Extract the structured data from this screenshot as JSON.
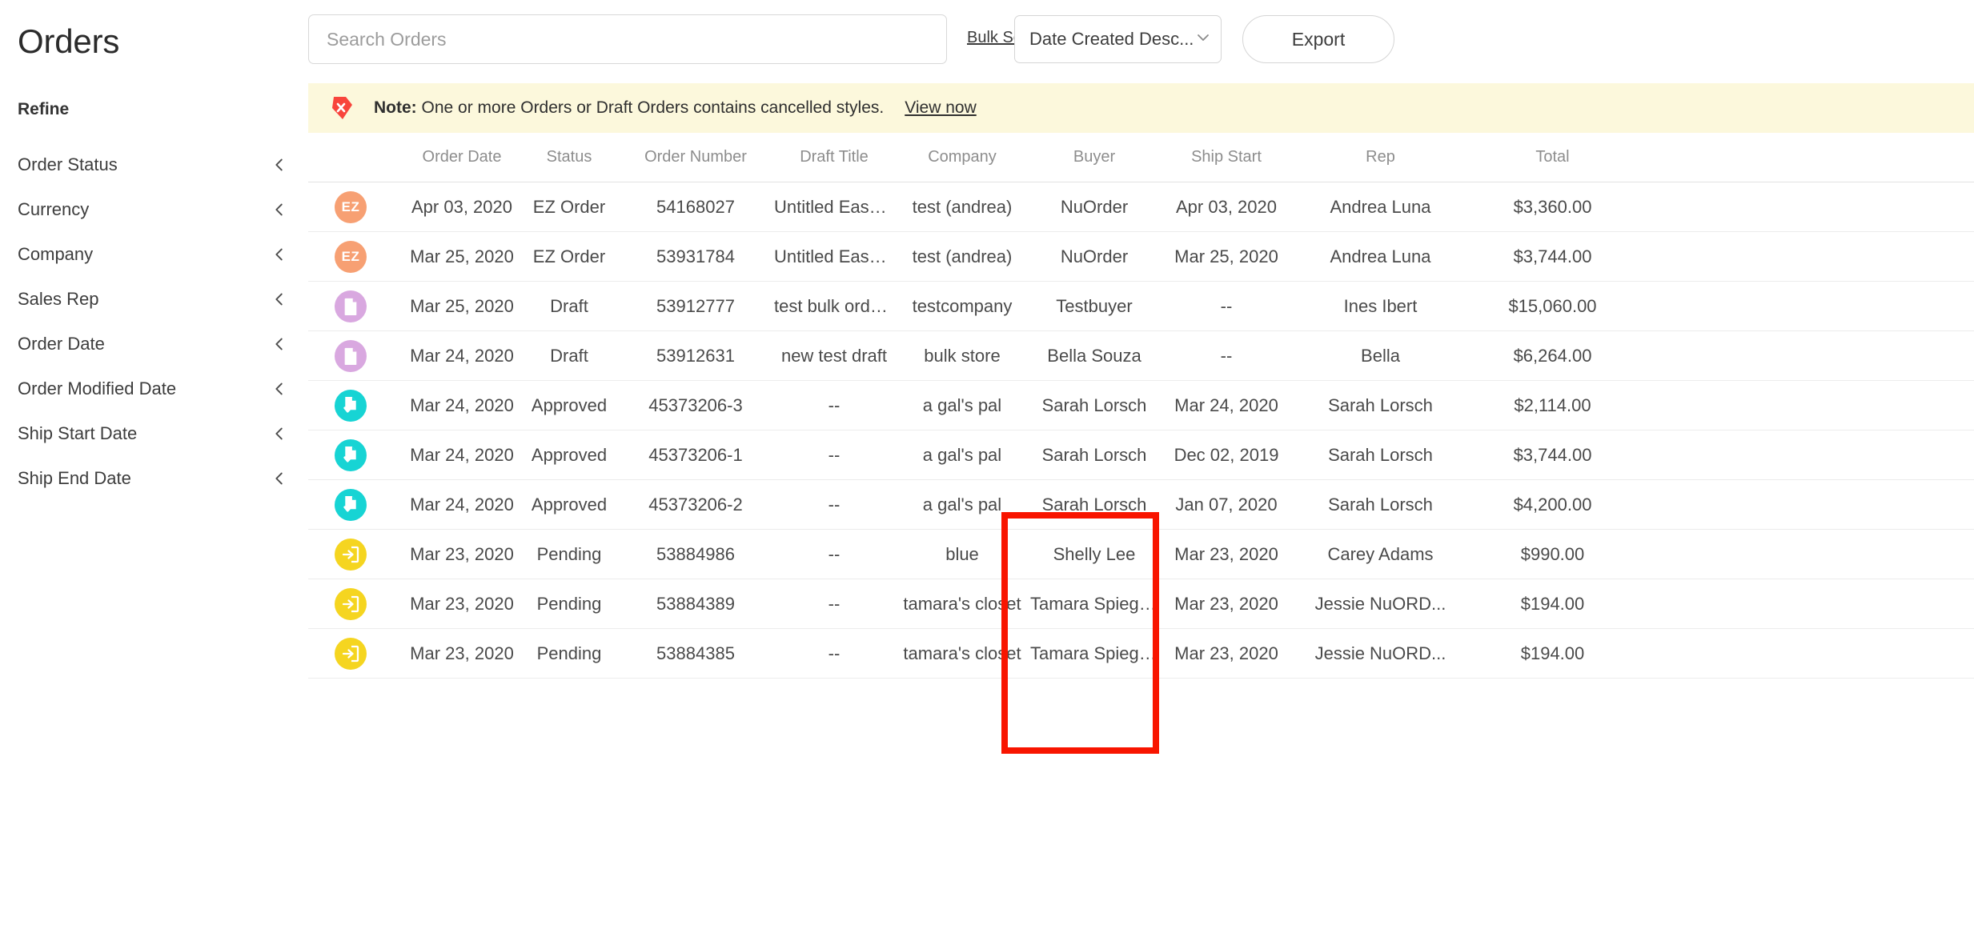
{
  "header": {
    "title": "Orders"
  },
  "sidebar": {
    "refine_label": "Refine",
    "items": [
      {
        "label": "Order Status",
        "icon": "chevron-left-icon"
      },
      {
        "label": "Currency",
        "icon": "chevron-left-icon"
      },
      {
        "label": "Company",
        "icon": "chevron-left-icon"
      },
      {
        "label": "Sales Rep",
        "icon": "chevron-left-icon"
      },
      {
        "label": "Order Date",
        "icon": "chevron-left-icon"
      },
      {
        "label": "Order Modified Date",
        "icon": "chevron-left-icon"
      },
      {
        "label": "Ship Start Date",
        "icon": "chevron-left-icon"
      },
      {
        "label": "Ship End Date",
        "icon": "chevron-left-icon"
      }
    ]
  },
  "toolbar": {
    "search_value": "",
    "search_placeholder": "Search Orders",
    "bulk_search_label": "Bulk Search",
    "sort_value": "Date Created Desc...",
    "sort_icon": "chevron-down-icon",
    "export_label": "Export"
  },
  "note": {
    "icon": "cancelled-tag-icon",
    "prefix": "Note:",
    "message": "One or more Orders or Draft Orders contains cancelled styles.",
    "link_label": "View now",
    "background": "#fcf8dc"
  },
  "table": {
    "columns": [
      {
        "key": "icon",
        "label": ""
      },
      {
        "key": "order_date",
        "label": "Order Date"
      },
      {
        "key": "status",
        "label": "Status"
      },
      {
        "key": "order_number",
        "label": "Order Number"
      },
      {
        "key": "draft_title",
        "label": "Draft Title"
      },
      {
        "key": "company",
        "label": "Company"
      },
      {
        "key": "buyer",
        "label": "Buyer"
      },
      {
        "key": "ship_start",
        "label": "Ship Start"
      },
      {
        "key": "rep",
        "label": "Rep"
      },
      {
        "key": "total",
        "label": "Total"
      }
    ],
    "rows": [
      {
        "icon": "ez-order-icon",
        "icon_color": "#f7a073",
        "icon_glyph": "EZ",
        "order_date": "Apr 03, 2020",
        "status": "EZ Order",
        "order_number": "54168027",
        "draft_title": "Untitled Easy ...",
        "company": "test (andrea)",
        "buyer": "NuOrder",
        "ship_start": "Apr 03, 2020",
        "rep": "Andrea Luna",
        "total": "$3,360.00"
      },
      {
        "icon": "ez-order-icon",
        "icon_color": "#f7a073",
        "icon_glyph": "EZ",
        "order_date": "Mar 25, 2020",
        "status": "EZ Order",
        "order_number": "53931784",
        "draft_title": "Untitled Easy ...",
        "company": "test (andrea)",
        "buyer": "NuOrder",
        "ship_start": "Mar 25, 2020",
        "rep": "Andrea Luna",
        "total": "$3,744.00"
      },
      {
        "icon": "draft-order-icon",
        "icon_color": "#d9a8e0",
        "icon_glyph": "document",
        "order_date": "Mar 25, 2020",
        "status": "Draft",
        "order_number": "53912777",
        "draft_title": "test bulk order...",
        "company": "testcompany",
        "buyer": "Testbuyer",
        "ship_start": "--",
        "rep": "Ines Ibert",
        "total": "$15,060.00"
      },
      {
        "icon": "draft-order-icon",
        "icon_color": "#d9a8e0",
        "icon_glyph": "document",
        "order_date": "Mar 24, 2020",
        "status": "Draft",
        "order_number": "53912631",
        "draft_title": "new test draft",
        "company": "bulk store",
        "buyer": "Bella Souza",
        "ship_start": "--",
        "rep": "Bella",
        "total": "$6,264.00"
      },
      {
        "icon": "approved-order-icon",
        "icon_color": "#17d4d4",
        "icon_glyph": "check-document",
        "order_date": "Mar 24, 2020",
        "status": "Approved",
        "order_number": "45373206-3",
        "draft_title": "--",
        "company": "a gal's pal",
        "buyer": "Sarah Lorsch",
        "ship_start": "Mar 24, 2020",
        "rep": "Sarah Lorsch",
        "total": "$2,114.00"
      },
      {
        "icon": "approved-order-icon",
        "icon_color": "#17d4d4",
        "icon_glyph": "check-document",
        "order_date": "Mar 24, 2020",
        "status": "Approved",
        "order_number": "45373206-1",
        "draft_title": "--",
        "company": "a gal's pal",
        "buyer": "Sarah Lorsch",
        "ship_start": "Dec 02, 2019",
        "rep": "Sarah Lorsch",
        "total": "$3,744.00"
      },
      {
        "icon": "approved-order-icon",
        "icon_color": "#17d4d4",
        "icon_glyph": "check-document",
        "order_date": "Mar 24, 2020",
        "status": "Approved",
        "order_number": "45373206-2",
        "draft_title": "--",
        "company": "a gal's pal",
        "buyer": "Sarah Lorsch",
        "ship_start": "Jan 07, 2020",
        "rep": "Sarah Lorsch",
        "total": "$4,200.00"
      },
      {
        "icon": "pending-order-icon",
        "icon_color": "#f5d520",
        "icon_glyph": "inbox",
        "order_date": "Mar 23, 2020",
        "status": "Pending",
        "order_number": "53884986",
        "draft_title": "--",
        "company": "blue",
        "buyer": "Shelly Lee",
        "ship_start": "Mar 23, 2020",
        "rep": "Carey Adams",
        "total": "$990.00"
      },
      {
        "icon": "pending-order-icon",
        "icon_color": "#f5d520",
        "icon_glyph": "inbox",
        "order_date": "Mar 23, 2020",
        "status": "Pending",
        "order_number": "53884389",
        "draft_title": "--",
        "company": "tamara's closet",
        "buyer": "Tamara Spiege...",
        "ship_start": "Mar 23, 2020",
        "rep": "Jessie NuORD...",
        "total": "$194.00"
      },
      {
        "icon": "pending-order-icon",
        "icon_color": "#f5d520",
        "icon_glyph": "inbox",
        "order_date": "Mar 23, 2020",
        "status": "Pending",
        "order_number": "53884385",
        "draft_title": "--",
        "company": "tamara's closet",
        "buyer": "Tamara Spiege...",
        "ship_start": "Mar 23, 2020",
        "rep": "Jessie NuORD...",
        "total": "$194.00"
      }
    ]
  },
  "annotation": {
    "highlight_color": "#f81500",
    "highlight_target": "order-number-column"
  }
}
